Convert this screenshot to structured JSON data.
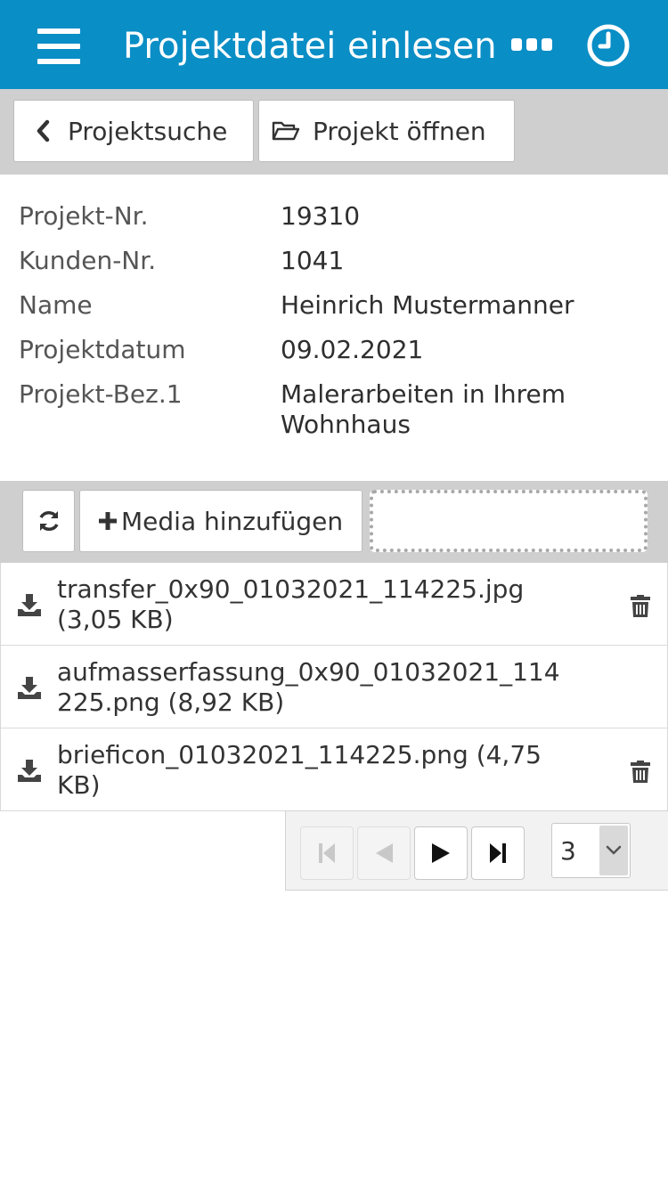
{
  "header": {
    "title": "Projektdatei einlesen",
    "menu_icon": "hamburger-menu-icon",
    "more_icon": "more-dots-icon",
    "history_icon": "clock-icon",
    "background_color": "#0a8ec6"
  },
  "toolbar": {
    "back_label": "Projektsuche",
    "open_label": "Projekt öffnen"
  },
  "project": {
    "rows": [
      {
        "label": "Projekt-Nr.",
        "value": "19310"
      },
      {
        "label": "Kunden-Nr.",
        "value": "1041"
      },
      {
        "label": "Name",
        "value": "Heinrich Mustermanner"
      },
      {
        "label": "Projektdatum",
        "value": "09.02.2021"
      },
      {
        "label": "Projekt-Bez.1",
        "value": "Malerarbeiten in Ihrem Wohnhaus"
      }
    ]
  },
  "media": {
    "add_label": "Media hinzufügen",
    "refresh_icon": "refresh-icon",
    "files": [
      {
        "name": "transfer_0x90_01032021_114225.jpg (3,05 KB)",
        "deletable": true
      },
      {
        "name": "aufmasserfassung_0x90_01032021_114225.png (8,92 KB)",
        "deletable": false
      },
      {
        "name": "brieficon_01032021_114225.png (4,75 KB)",
        "deletable": true
      }
    ]
  },
  "pager": {
    "page": "3",
    "first_icon": "first-page-icon",
    "prev_icon": "previous-page-icon",
    "next_icon": "next-page-icon",
    "last_icon": "last-page-icon"
  }
}
